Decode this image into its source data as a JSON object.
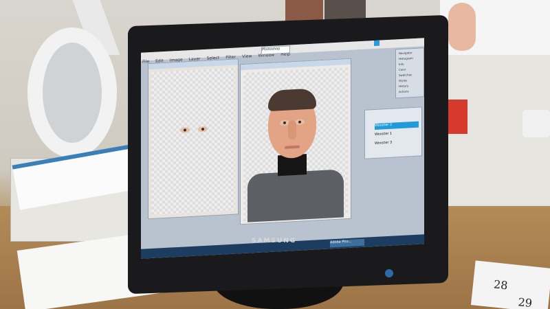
{
  "photo": {
    "monitor_brand": "SAMSUNG",
    "calendar_dates": [
      "28",
      "29"
    ],
    "colors": {
      "bezel": "#1a1a1c",
      "selected_layer": "#1e9bd8",
      "taskbar": "#1c3d60",
      "socket_red": "#d53a2c"
    }
  },
  "screen": {
    "menu_items": [
      "File",
      "Edit",
      "Image",
      "Layer",
      "Select",
      "Filter",
      "View",
      "Window",
      "Help"
    ],
    "title_pill": "Photoshop",
    "window_left_title": "",
    "window_right_title": "",
    "toolbox_items": [
      "Navigator",
      "Histogram",
      "Info",
      "Color",
      "Swatches",
      "Styles",
      "History",
      "Actions"
    ],
    "layers": [
      "Wooster 2",
      "Wooster 1",
      "Wooster 3"
    ],
    "selected_layer": "Wooster 2",
    "task_item": "Adobe Pho..."
  }
}
